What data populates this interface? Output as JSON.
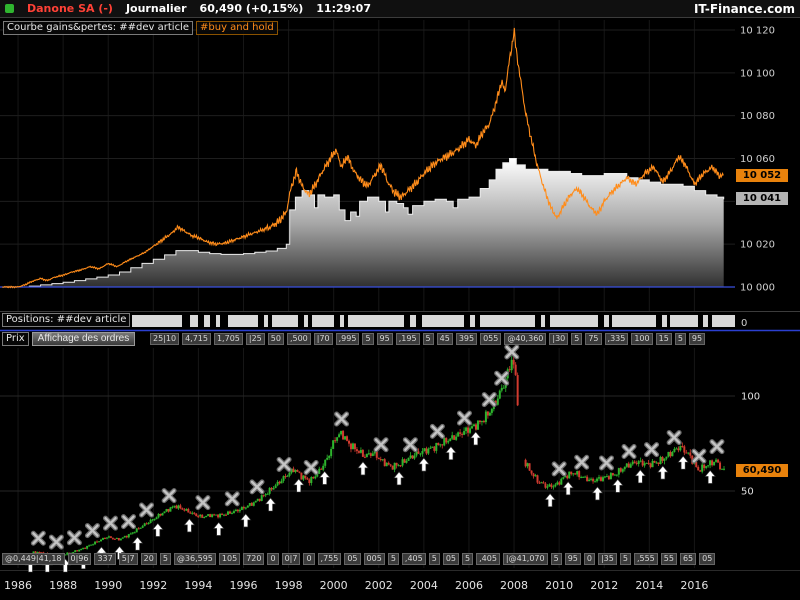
{
  "header": {
    "instrument": "Danone SA (-)",
    "timeframe": "Journalier",
    "quote": "60,490 (+0,15%)",
    "time": "11:29:07",
    "brand": "IT-Finance.com"
  },
  "equity_panel": {
    "label": "Courbe gains&pertes: ##dev article",
    "buyhold_label": "#buy and hold",
    "badges": {
      "buy_hold": {
        "label": "10 052",
        "value": 10052
      },
      "strategy": {
        "label": "10 041",
        "value": 10041
      }
    },
    "axis": [
      {
        "label": "10 120",
        "value": 10120
      },
      {
        "label": "10 100",
        "value": 10100
      },
      {
        "label": "10 080",
        "value": 10080
      },
      {
        "label": "10 060",
        "value": 10060
      },
      {
        "label": "10 020",
        "value": 10020
      },
      {
        "label": "10 000",
        "value": 10000
      }
    ],
    "baseline_value": 10000
  },
  "positions_panel": {
    "label": "Positions: ##dev article",
    "axis_label": "0",
    "segments": [
      [
        132,
        50
      ],
      [
        190,
        8
      ],
      [
        204,
        6
      ],
      [
        216,
        4
      ],
      [
        228,
        30
      ],
      [
        264,
        4
      ],
      [
        272,
        26
      ],
      [
        304,
        4
      ],
      [
        312,
        22
      ],
      [
        340,
        4
      ],
      [
        348,
        56
      ],
      [
        410,
        6
      ],
      [
        422,
        42
      ],
      [
        470,
        5
      ],
      [
        480,
        55
      ],
      [
        541,
        4
      ],
      [
        550,
        48
      ],
      [
        604,
        5
      ],
      [
        612,
        44
      ],
      [
        662,
        5
      ],
      [
        670,
        28
      ],
      [
        703,
        5
      ],
      [
        712,
        23
      ]
    ]
  },
  "price_panel": {
    "label": "Prix",
    "button": "Affichage des ordres",
    "badge": {
      "label": "60,490",
      "value": 60.49
    },
    "axis": [
      {
        "label": "100",
        "value": 100
      },
      {
        "label": "50",
        "value": 50
      }
    ],
    "orders_top": [
      "25|10",
      "4,715",
      "1,705",
      "|25",
      "50",
      ",500",
      "|70",
      ",995",
      "5",
      "95",
      ",195",
      "5",
      "45",
      "395",
      "055",
      "@40,360",
      "|30",
      "5",
      "75",
      ",335",
      "100",
      "15",
      "5",
      "95"
    ],
    "orders_bottom": [
      "@0,449|41,18",
      "0|96",
      "337",
      "5|7",
      "20",
      "5",
      "@36,595",
      "105",
      "720",
      "0",
      "0|7",
      "0",
      ",755",
      "05",
      "005",
      "5",
      ",405",
      "5",
      "05",
      "5",
      ",405",
      "|@41,070",
      "5",
      "95",
      "0",
      "|35",
      "5",
      ",555",
      "55",
      "65",
      "05"
    ],
    "years": [
      1986,
      1988,
      1990,
      1992,
      1994,
      1996,
      1998,
      2000,
      2002,
      2004,
      2006,
      2008,
      2010,
      2012,
      2014,
      2016
    ]
  },
  "colors": {
    "accent_orange": "#e8820c",
    "buy_hold_line": "#ff8c1a",
    "baseline_blue": "#3950e0",
    "separator_blue": "#2b3fd0",
    "candle_up": "#2db52d",
    "candle_down": "#d03b2f",
    "positions_block": "#d9d9d9",
    "equity_edge": "#ececec",
    "instrument_red": "#ff4136",
    "status_green": "#2fb52f"
  },
  "chart_data": [
    {
      "type": "area",
      "name": "Courbe gains&pertes (##dev article)",
      "x_range": [
        1986,
        2017.3
      ],
      "ylim": [
        10000,
        10120
      ],
      "last_value": 10041,
      "points": [
        [
          1985.3,
          10000
        ],
        [
          1986,
          10000
        ],
        [
          1986.5,
          10000.4
        ],
        [
          1987,
          10001
        ],
        [
          1987.5,
          10001.6
        ],
        [
          1988,
          10002.2
        ],
        [
          1988.5,
          10003
        ],
        [
          1989,
          10003.8
        ],
        [
          1989.5,
          10004.6
        ],
        [
          1990,
          10005.6
        ],
        [
          1990.5,
          10007
        ],
        [
          1991,
          10009
        ],
        [
          1991.5,
          10011
        ],
        [
          1992,
          10013
        ],
        [
          1992.5,
          10015
        ],
        [
          1993,
          10017
        ],
        [
          1993.5,
          10017
        ],
        [
          1994,
          10016.2
        ],
        [
          1994.5,
          10015.6
        ],
        [
          1995,
          10015.2
        ],
        [
          1995.5,
          10015.2
        ],
        [
          1996,
          10015.6
        ],
        [
          1996.5,
          10016.2
        ],
        [
          1997,
          10016.8
        ],
        [
          1997.5,
          10018
        ],
        [
          1997.9,
          10020
        ],
        [
          1998.05,
          10036
        ],
        [
          1998.3,
          10042
        ],
        [
          1998.6,
          10045
        ],
        [
          1998.9,
          10043
        ],
        [
          1999.15,
          10037
        ],
        [
          1999.3,
          10043
        ],
        [
          1999.6,
          10042
        ],
        [
          2000,
          10043
        ],
        [
          2000.25,
          10036
        ],
        [
          2000.5,
          10031
        ],
        [
          2000.75,
          10035
        ],
        [
          2001,
          10033
        ],
        [
          2001.15,
          10040
        ],
        [
          2001.5,
          10042
        ],
        [
          2002,
          10040
        ],
        [
          2002.3,
          10035
        ],
        [
          2002.45,
          10040
        ],
        [
          2002.8,
          10039
        ],
        [
          2003.1,
          10037
        ],
        [
          2003.3,
          10034
        ],
        [
          2003.5,
          10038
        ],
        [
          2004,
          10040
        ],
        [
          2004.5,
          10041
        ],
        [
          2005,
          10040
        ],
        [
          2005.3,
          10037
        ],
        [
          2005.5,
          10041
        ],
        [
          2006,
          10042
        ],
        [
          2006.5,
          10046
        ],
        [
          2006.9,
          10050
        ],
        [
          2007.2,
          10055
        ],
        [
          2007.5,
          10058
        ],
        [
          2007.8,
          10060
        ],
        [
          2008.1,
          10057
        ],
        [
          2008.5,
          10055
        ],
        [
          2009,
          10055
        ],
        [
          2009.5,
          10054
        ],
        [
          2010,
          10054
        ],
        [
          2010.5,
          10053
        ],
        [
          2011,
          10052
        ],
        [
          2011.5,
          10052
        ],
        [
          2012,
          10053
        ],
        [
          2012.5,
          10053
        ],
        [
          2013,
          10051
        ],
        [
          2013.5,
          10050
        ],
        [
          2014,
          10049
        ],
        [
          2014.5,
          10048
        ],
        [
          2015,
          10048
        ],
        [
          2015.5,
          10047
        ],
        [
          2016,
          10045
        ],
        [
          2016.5,
          10043
        ],
        [
          2017,
          10042
        ],
        [
          2017.3,
          10041
        ]
      ]
    },
    {
      "type": "line",
      "name": "#buy and hold",
      "x_range": [
        1986,
        2017.3
      ],
      "ylim": [
        10000,
        10120
      ],
      "last_value": 10052,
      "points": [
        [
          1985.3,
          10000
        ],
        [
          1986,
          10000
        ],
        [
          1986.3,
          10001
        ],
        [
          1986.6,
          10002.5
        ],
        [
          1987,
          10004
        ],
        [
          1987.3,
          10003
        ],
        [
          1987.6,
          10004.5
        ],
        [
          1988,
          10005.5
        ],
        [
          1988.4,
          10007
        ],
        [
          1988.8,
          10008
        ],
        [
          1989.2,
          10009.5
        ],
        [
          1989.6,
          10008.5
        ],
        [
          1990,
          10011
        ],
        [
          1990.4,
          10009.5
        ],
        [
          1990.8,
          10012
        ],
        [
          1991.2,
          10014
        ],
        [
          1991.6,
          10016
        ],
        [
          1992,
          10019
        ],
        [
          1992.4,
          10022
        ],
        [
          1992.8,
          10025
        ],
        [
          1993.1,
          10028
        ],
        [
          1993.4,
          10026
        ],
        [
          1993.7,
          10024
        ],
        [
          1994,
          10023
        ],
        [
          1994.4,
          10021
        ],
        [
          1994.8,
          10020
        ],
        [
          1995.2,
          10020.5
        ],
        [
          1995.6,
          10022
        ],
        [
          1996,
          10023.5
        ],
        [
          1996.4,
          10025
        ],
        [
          1996.8,
          10026.5
        ],
        [
          1997.2,
          10028
        ],
        [
          1997.6,
          10031
        ],
        [
          1997.9,
          10035
        ],
        [
          1998.1,
          10046
        ],
        [
          1998.35,
          10054
        ],
        [
          1998.6,
          10047
        ],
        [
          1998.9,
          10043
        ],
        [
          1999.2,
          10048
        ],
        [
          1999.5,
          10054
        ],
        [
          1999.8,
          10059
        ],
        [
          2000.1,
          10064
        ],
        [
          2000.35,
          10056
        ],
        [
          2000.6,
          10061
        ],
        [
          2000.9,
          10054
        ],
        [
          2001.2,
          10050
        ],
        [
          2001.5,
          10047
        ],
        [
          2001.8,
          10052
        ],
        [
          2002.1,
          10057
        ],
        [
          2002.4,
          10049
        ],
        [
          2002.7,
          10044
        ],
        [
          2003,
          10042
        ],
        [
          2003.3,
          10045
        ],
        [
          2003.7,
          10049
        ],
        [
          2004,
          10053
        ],
        [
          2004.4,
          10057
        ],
        [
          2004.8,
          10060
        ],
        [
          2005.2,
          10062
        ],
        [
          2005.6,
          10065
        ],
        [
          2006,
          10069
        ],
        [
          2006.3,
          10066
        ],
        [
          2006.6,
          10072
        ],
        [
          2006.9,
          10076
        ],
        [
          2007.2,
          10086
        ],
        [
          2007.45,
          10096
        ],
        [
          2007.6,
          10091
        ],
        [
          2007.75,
          10103
        ],
        [
          2007.9,
          10112
        ],
        [
          2008,
          10120
        ],
        [
          2008.1,
          10110
        ],
        [
          2008.3,
          10096
        ],
        [
          2008.5,
          10082
        ],
        [
          2008.7,
          10072
        ],
        [
          2009,
          10058
        ],
        [
          2009.3,
          10047
        ],
        [
          2009.6,
          10038
        ],
        [
          2009.9,
          10032
        ],
        [
          2010.2,
          10038
        ],
        [
          2010.5,
          10043
        ],
        [
          2010.8,
          10046
        ],
        [
          2011.1,
          10042
        ],
        [
          2011.4,
          10037
        ],
        [
          2011.7,
          10034
        ],
        [
          2012,
          10040
        ],
        [
          2012.3,
          10044
        ],
        [
          2012.6,
          10047
        ],
        [
          2013,
          10051
        ],
        [
          2013.4,
          10048
        ],
        [
          2013.8,
          10053
        ],
        [
          2014.2,
          10056
        ],
        [
          2014.6,
          10049
        ],
        [
          2015,
          10055
        ],
        [
          2015.3,
          10061
        ],
        [
          2015.6,
          10057
        ],
        [
          2016,
          10048
        ],
        [
          2016.4,
          10053
        ],
        [
          2016.8,
          10056
        ],
        [
          2017.1,
          10052
        ],
        [
          2017.3,
          10052
        ]
      ]
    },
    {
      "type": "candlestick",
      "name": "Prix Danone SA",
      "x_range": [
        1986,
        2017.3
      ],
      "ylim": [
        0,
        125
      ],
      "gap": [
        2008.12,
        2008.42
      ],
      "last_price": 60.49,
      "points": [
        [
          1985.5,
          13
        ],
        [
          1986,
          14
        ],
        [
          1986.4,
          16
        ],
        [
          1986.8,
          18
        ],
        [
          1987.2,
          17
        ],
        [
          1987.6,
          15.5
        ],
        [
          1988,
          16.5
        ],
        [
          1988.5,
          18
        ],
        [
          1989,
          20
        ],
        [
          1989.5,
          23
        ],
        [
          1990,
          26
        ],
        [
          1990.5,
          24.5
        ],
        [
          1991,
          27
        ],
        [
          1991.5,
          31
        ],
        [
          1992,
          35
        ],
        [
          1992.5,
          39
        ],
        [
          1993,
          42
        ],
        [
          1993.4,
          40
        ],
        [
          1993.8,
          38
        ],
        [
          1994.2,
          36.5
        ],
        [
          1994.6,
          37.5
        ],
        [
          1995,
          37
        ],
        [
          1995.5,
          38.5
        ],
        [
          1996,
          41
        ],
        [
          1996.5,
          44
        ],
        [
          1997,
          48
        ],
        [
          1997.5,
          53
        ],
        [
          1998,
          59
        ],
        [
          1998.3,
          62
        ],
        [
          1998.6,
          58
        ],
        [
          1999,
          55
        ],
        [
          1999.4,
          60
        ],
        [
          1999.8,
          68
        ],
        [
          2000.1,
          78
        ],
        [
          2000.4,
          81
        ],
        [
          2000.7,
          75
        ],
        [
          2001,
          72
        ],
        [
          2001.4,
          68
        ],
        [
          2001.8,
          70
        ],
        [
          2002.2,
          66
        ],
        [
          2002.6,
          63
        ],
        [
          2003,
          64
        ],
        [
          2003.4,
          67
        ],
        [
          2003.8,
          70
        ],
        [
          2004.2,
          72
        ],
        [
          2004.6,
          74
        ],
        [
          2005,
          76
        ],
        [
          2005.4,
          78
        ],
        [
          2005.8,
          81
        ],
        [
          2006.2,
          84
        ],
        [
          2006.6,
          87
        ],
        [
          2007,
          92
        ],
        [
          2007.3,
          98
        ],
        [
          2007.6,
          106
        ],
        [
          2007.8,
          113
        ],
        [
          2007.95,
          120
        ],
        [
          2008.1,
          112
        ],
        [
          2008.45,
          67
        ],
        [
          2008.8,
          60
        ],
        [
          2009.1,
          55
        ],
        [
          2009.5,
          52
        ],
        [
          2009.9,
          53
        ],
        [
          2010.3,
          58
        ],
        [
          2010.7,
          60
        ],
        [
          2011.1,
          57
        ],
        [
          2011.5,
          55
        ],
        [
          2012,
          57
        ],
        [
          2012.5,
          59
        ],
        [
          2013,
          63
        ],
        [
          2013.5,
          65
        ],
        [
          2014,
          64
        ],
        [
          2014.5,
          66
        ],
        [
          2015,
          70
        ],
        [
          2015.4,
          73
        ],
        [
          2015.8,
          69
        ],
        [
          2016.2,
          61
        ],
        [
          2016.6,
          64
        ],
        [
          2017,
          66
        ],
        [
          2017.3,
          60.5
        ]
      ],
      "trades": {
        "buy_years": [
          1986.55,
          1987.3,
          1988.1,
          1988.9,
          1989.7,
          1990.5,
          1991.3,
          1992.2,
          1993.6,
          1994.9,
          1996.1,
          1997.2,
          1998.45,
          1999.6,
          2001.3,
          2002.9,
          2004.0,
          2005.2,
          2006.3,
          2009.6,
          2010.4,
          2011.7,
          2012.6,
          2013.6,
          2014.6,
          2015.5,
          2016.7
        ],
        "sell_years": [
          1986.9,
          1987.7,
          1988.5,
          1989.3,
          1990.1,
          1990.9,
          1991.7,
          1992.7,
          1994.2,
          1995.5,
          1996.6,
          1997.8,
          1999.0,
          2000.35,
          2002.1,
          2003.4,
          2004.6,
          2005.8,
          2006.9,
          2007.45,
          2007.9,
          2010.0,
          2011.0,
          2012.1,
          2013.1,
          2014.1,
          2015.1,
          2016.2,
          2017.0
        ]
      }
    }
  ]
}
